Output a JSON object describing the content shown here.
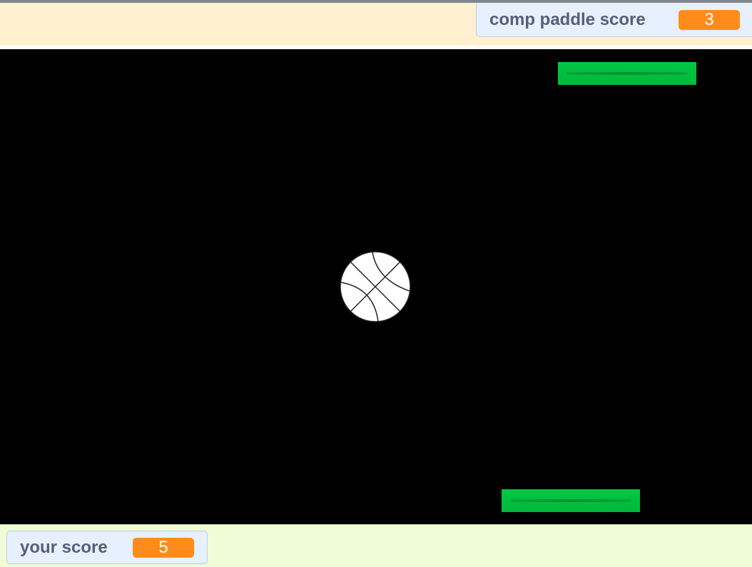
{
  "scoreboard": {
    "computer": {
      "label": "comp paddle score",
      "value": "3"
    },
    "player": {
      "label": "your score",
      "value": "5"
    }
  },
  "colors": {
    "header_strip": "#fff1d0",
    "footer_strip": "#eefdd6",
    "playfield": "#000000",
    "paddle": "#00c843",
    "score_badge": "#ff8c1a",
    "monitor_text": "#575e75"
  },
  "sprites": {
    "computer_paddle": "paddle",
    "player_paddle": "paddle",
    "ball": "basketball-icon"
  }
}
